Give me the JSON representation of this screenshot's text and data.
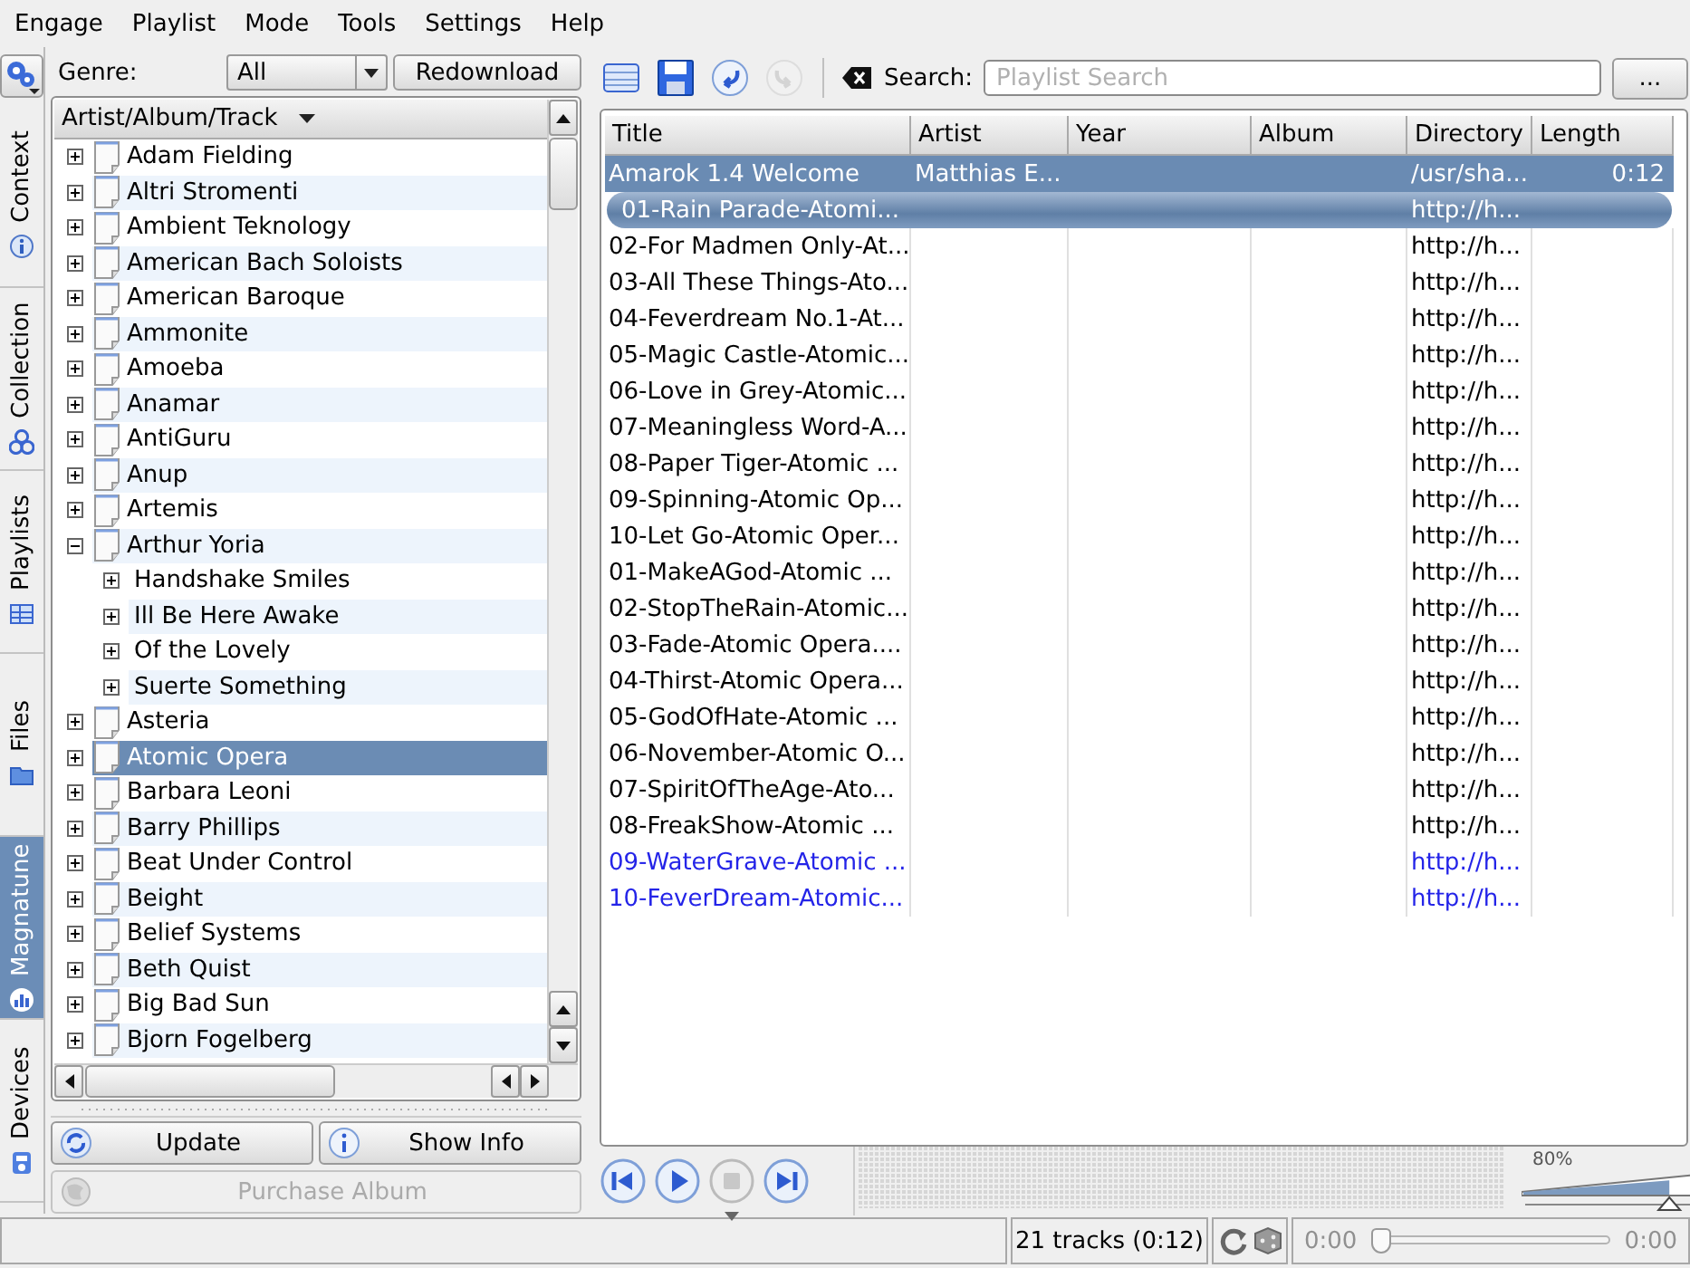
{
  "menu": [
    "Engage",
    "Playlist",
    "Mode",
    "Tools",
    "Settings",
    "Help"
  ],
  "side_tabs": [
    {
      "label": "Context",
      "selected": false
    },
    {
      "label": "Collection",
      "selected": false
    },
    {
      "label": "Playlists",
      "selected": false
    },
    {
      "label": "Files",
      "selected": false
    },
    {
      "label": "Magnatune",
      "selected": true
    },
    {
      "label": "Devices",
      "selected": false
    }
  ],
  "collection": {
    "genre_label": "Genre:",
    "genre": "All",
    "redownload_button": "Redownload",
    "tree_header": "Artist/Album/Track",
    "tree": [
      {
        "label": "Adam Fielding",
        "expanded": false,
        "selected": false
      },
      {
        "label": "Altri Stromenti",
        "expanded": false,
        "selected": false
      },
      {
        "label": "Ambient Teknology",
        "expanded": false,
        "selected": false
      },
      {
        "label": "American Bach Soloists",
        "expanded": false,
        "selected": false
      },
      {
        "label": "American Baroque",
        "expanded": false,
        "selected": false
      },
      {
        "label": "Ammonite",
        "expanded": false,
        "selected": false
      },
      {
        "label": "Amoeba",
        "expanded": false,
        "selected": false
      },
      {
        "label": "Anamar",
        "expanded": false,
        "selected": false
      },
      {
        "label": "AntiGuru",
        "expanded": false,
        "selected": false
      },
      {
        "label": "Anup",
        "expanded": false,
        "selected": false
      },
      {
        "label": "Artemis",
        "expanded": false,
        "selected": false
      },
      {
        "label": "Arthur Yoria",
        "expanded": true,
        "selected": false,
        "children": [
          {
            "label": "Handshake Smiles",
            "expanded": false,
            "selected": false
          },
          {
            "label": "Ill Be Here Awake",
            "expanded": false,
            "selected": false
          },
          {
            "label": "Of the Lovely",
            "expanded": false,
            "selected": false
          },
          {
            "label": "Suerte Something",
            "expanded": false,
            "selected": false
          }
        ]
      },
      {
        "label": "Asteria",
        "expanded": false,
        "selected": false
      },
      {
        "label": "Atomic Opera",
        "expanded": false,
        "selected": true
      },
      {
        "label": "Barbara Leoni",
        "expanded": false,
        "selected": false
      },
      {
        "label": "Barry Phillips",
        "expanded": false,
        "selected": false
      },
      {
        "label": "Beat Under Control",
        "expanded": false,
        "selected": false
      },
      {
        "label": "Beight",
        "expanded": false,
        "selected": false
      },
      {
        "label": "Belief Systems",
        "expanded": false,
        "selected": false
      },
      {
        "label": "Beth Quist",
        "expanded": false,
        "selected": false
      },
      {
        "label": "Big Bad Sun",
        "expanded": false,
        "selected": false
      },
      {
        "label": "Bjorn Fogelberg",
        "expanded": false,
        "selected": false
      }
    ],
    "buttons": [
      {
        "label": "Update",
        "disabled": false
      },
      {
        "label": "Show Info",
        "disabled": false
      },
      {
        "label": "Purchase Album",
        "disabled": true
      }
    ]
  },
  "playlist": {
    "toolbar": [
      {
        "kind": "grid",
        "disabled": false
      },
      {
        "kind": "save",
        "disabled": false
      },
      {
        "kind": "undo",
        "disabled": false
      },
      {
        "kind": "redo",
        "disabled": true
      }
    ],
    "search_label": "Search:",
    "search": {
      "placeholder": "Playlist Search"
    },
    "options_button": "...",
    "columns": [
      "Title",
      "Artist",
      "Year",
      "Album",
      "Directory",
      "Length"
    ],
    "tracks": [
      {
        "title": "Amarok 1.4 Welcome",
        "artist": "Matthias E...",
        "directory": "/usr/sha...",
        "length": "0:12",
        "selected": true,
        "playing": false,
        "highlighted": false
      },
      {
        "title": "01-Rain Parade-Atomi...",
        "directory": "http://h...",
        "selected": false,
        "playing": true,
        "highlighted": false
      },
      {
        "title": "02-For Madmen Only-At...",
        "directory": "http://h...",
        "selected": false,
        "playing": false,
        "highlighted": false
      },
      {
        "title": "03-All These Things-Ato...",
        "directory": "http://h...",
        "selected": false,
        "playing": false,
        "highlighted": false
      },
      {
        "title": "04-Feverdream No.1-At...",
        "directory": "http://h...",
        "selected": false,
        "playing": false,
        "highlighted": false
      },
      {
        "title": "05-Magic Castle-Atomic...",
        "directory": "http://h...",
        "selected": false,
        "playing": false,
        "highlighted": false
      },
      {
        "title": "06-Love in Grey-Atomic...",
        "directory": "http://h...",
        "selected": false,
        "playing": false,
        "highlighted": false
      },
      {
        "title": "07-Meaningless Word-A...",
        "directory": "http://h...",
        "selected": false,
        "playing": false,
        "highlighted": false
      },
      {
        "title": "08-Paper Tiger-Atomic ...",
        "directory": "http://h...",
        "selected": false,
        "playing": false,
        "highlighted": false
      },
      {
        "title": "09-Spinning-Atomic Op...",
        "directory": "http://h...",
        "selected": false,
        "playing": false,
        "highlighted": false
      },
      {
        "title": "10-Let Go-Atomic Oper...",
        "directory": "http://h...",
        "selected": false,
        "playing": false,
        "highlighted": false
      },
      {
        "title": "01-MakeAGod-Atomic ...",
        "directory": "http://h...",
        "selected": false,
        "playing": false,
        "highlighted": false
      },
      {
        "title": "02-StopTheRain-Atomic...",
        "directory": "http://h...",
        "selected": false,
        "playing": false,
        "highlighted": false
      },
      {
        "title": "03-Fade-Atomic Opera....",
        "directory": "http://h...",
        "selected": false,
        "playing": false,
        "highlighted": false
      },
      {
        "title": "04-Thirst-Atomic Opera...",
        "directory": "http://h...",
        "selected": false,
        "playing": false,
        "highlighted": false
      },
      {
        "title": "05-GodOfHate-Atomic ...",
        "directory": "http://h...",
        "selected": false,
        "playing": false,
        "highlighted": false
      },
      {
        "title": "06-November-Atomic O...",
        "directory": "http://h...",
        "selected": false,
        "playing": false,
        "highlighted": false
      },
      {
        "title": "07-SpiritOfTheAge-Ato...",
        "directory": "http://h...",
        "selected": false,
        "playing": false,
        "highlighted": false
      },
      {
        "title": "08-FreakShow-Atomic ...",
        "directory": "http://h...",
        "selected": false,
        "playing": false,
        "highlighted": false
      },
      {
        "title": "09-WaterGrave-Atomic ...",
        "directory": "http://h...",
        "selected": false,
        "playing": false,
        "highlighted": true
      },
      {
        "title": "10-FeverDream-Atomic...",
        "directory": "http://h...",
        "selected": false,
        "playing": false,
        "highlighted": true
      }
    ]
  },
  "player": {
    "controls": [
      {
        "kind": "previous",
        "disabled": false
      },
      {
        "kind": "play",
        "disabled": false
      },
      {
        "kind": "stop",
        "disabled": true
      },
      {
        "kind": "next",
        "disabled": false
      }
    ],
    "volume": {
      "label": "80%",
      "level": 0.8
    }
  },
  "status_bar": {
    "tracks": "21 tracks (0:12)",
    "position": {
      "elapsed": "0:00",
      "remaining": "0:00",
      "level": 0,
      "disabled": true
    }
  }
}
